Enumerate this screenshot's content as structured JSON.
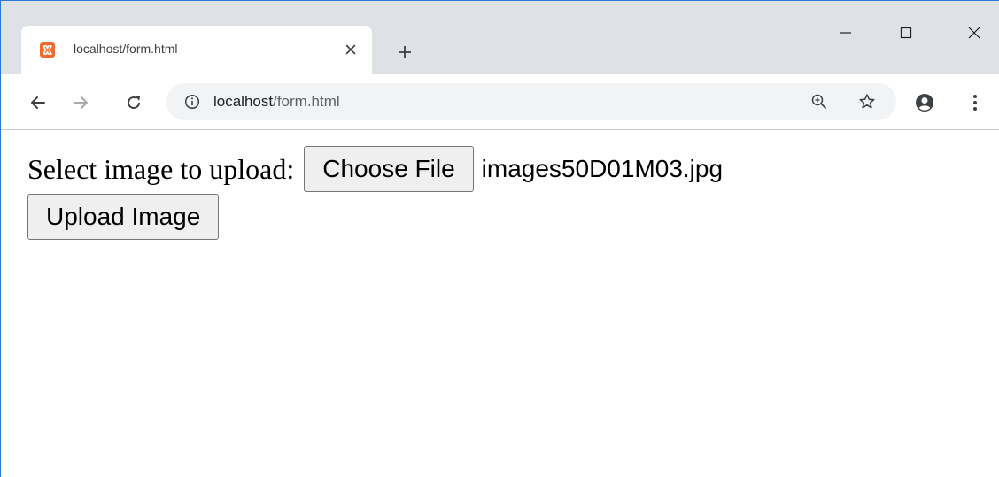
{
  "tab": {
    "title": "localhost/form.html",
    "favicon": "xampp-icon"
  },
  "window_controls": {
    "minimize": "minimize-icon",
    "maximize": "maximize-icon",
    "close": "close-icon"
  },
  "address_bar": {
    "url_host": "localhost",
    "url_path": "/form.html"
  },
  "page": {
    "label": "Select image to upload:",
    "choose_file_label": "Choose File",
    "selected_file": "images50D01M03.jpg",
    "upload_label": "Upload Image"
  },
  "colors": {
    "tabstrip_bg": "#dee1e6",
    "favicon": "#f16a2d",
    "omnibox_bg": "#f1f3f4",
    "window_border": "#2b79d0"
  }
}
